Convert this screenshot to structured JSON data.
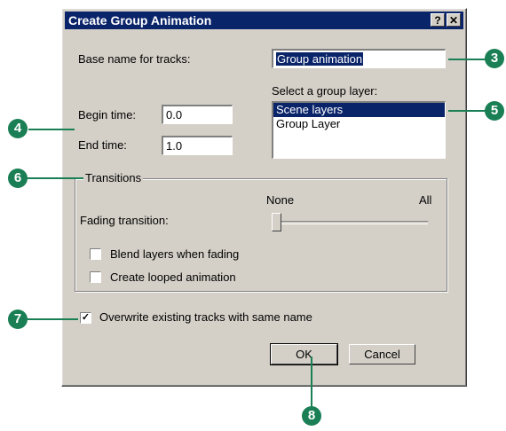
{
  "dialog": {
    "title": "Create Group Animation",
    "help_button": "?",
    "close_button": "✕"
  },
  "base_name": {
    "label": "Base name for tracks:",
    "value": "Group animation"
  },
  "group_layer": {
    "label": "Select a group layer:",
    "items": [
      "Scene layers",
      "Group Layer"
    ],
    "selected": "Scene layers"
  },
  "begin_time": {
    "label": "Begin time:",
    "value": "0.0"
  },
  "end_time": {
    "label": "End time:",
    "value": "1.0"
  },
  "transitions": {
    "legend": "Transitions",
    "fading_label": "Fading transition:",
    "slider_min_label": "None",
    "slider_max_label": "All",
    "slider_level": 0,
    "blend_label": "Blend layers when fading",
    "blend_checked": false,
    "looped_label": "Create looped animation",
    "looped_checked": false
  },
  "overwrite": {
    "label": "Overwrite existing tracks with same name",
    "checked": true
  },
  "buttons": {
    "ok": "OK",
    "cancel": "Cancel"
  },
  "callouts": [
    "3",
    "4",
    "5",
    "6",
    "7",
    "8"
  ],
  "colors": {
    "titlebar": "#0a246a",
    "callout": "#1a7f55",
    "dialog": "#d4d0c8"
  }
}
